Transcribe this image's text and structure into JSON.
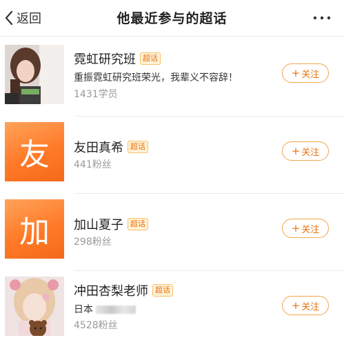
{
  "nav": {
    "back_label": "返回",
    "title": "他最近参与的超话"
  },
  "items": [
    {
      "name": "霓虹研究班",
      "badge": "超话",
      "description": "重振霓虹研究班荣光，我辈义不容辞！",
      "stat": "1431学员",
      "follow_label": "关注",
      "avatar_type": "photo"
    },
    {
      "name": "友田真希",
      "badge": "超话",
      "stat": "441粉丝",
      "follow_label": "关注",
      "avatar_type": "letter",
      "avatar_letter": "友",
      "avatar_color": "#ff7a28"
    },
    {
      "name": "加山夏子",
      "badge": "超话",
      "stat": "298粉丝",
      "follow_label": "关注",
      "avatar_type": "letter",
      "avatar_letter": "加",
      "avatar_color": "#ff7a28"
    },
    {
      "name": "冲田杏梨老师",
      "badge": "超话",
      "location": "日本",
      "stat": "4528粉丝",
      "follow_label": "关注",
      "avatar_type": "photo"
    }
  ],
  "colors": {
    "accent": "#e8730e",
    "badge_bg": "#fff1d6",
    "avatar_orange": "#ff7a28"
  }
}
